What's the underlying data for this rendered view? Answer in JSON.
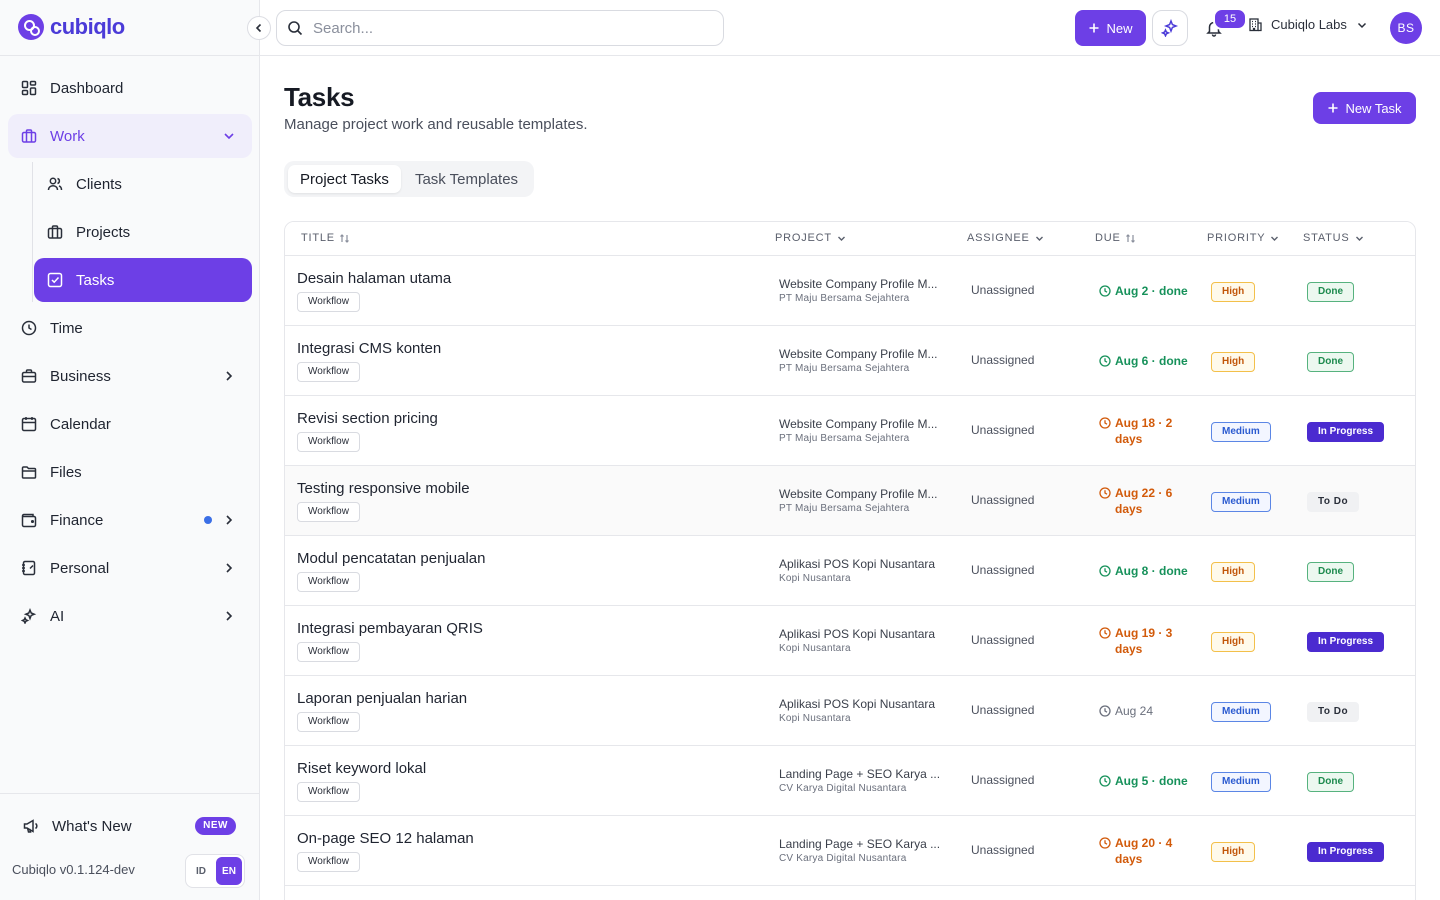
{
  "brand": {
    "name": "cubiqlo"
  },
  "sidebar": {
    "items": [
      {
        "label": "Dashboard",
        "icon": "dashboard-icon"
      },
      {
        "label": "Work",
        "icon": "briefcase-icon",
        "expanded": true,
        "children": [
          {
            "label": "Clients",
            "icon": "users-icon"
          },
          {
            "label": "Projects",
            "icon": "briefcase-icon"
          },
          {
            "label": "Tasks",
            "icon": "checkbox-icon",
            "active": true
          }
        ]
      },
      {
        "label": "Time",
        "icon": "clock-icon"
      },
      {
        "label": "Business",
        "icon": "briefcase-icon"
      },
      {
        "label": "Calendar",
        "icon": "calendar-icon"
      },
      {
        "label": "Files",
        "icon": "folder-icon"
      },
      {
        "label": "Finance",
        "icon": "wallet-icon",
        "indicator": true
      },
      {
        "label": "Personal",
        "icon": "notebook-icon"
      },
      {
        "label": "AI",
        "icon": "sparkles-icon"
      }
    ],
    "whats_new": {
      "label": "What's New",
      "badge": "NEW"
    },
    "version": "Cubiqlo v0.1.124-dev",
    "languages": [
      "ID",
      "EN"
    ],
    "active_language": "EN"
  },
  "topbar": {
    "search_placeholder": "Search...",
    "new_label": "New",
    "notification_count": "15",
    "org_name": "Cubiqlo Labs",
    "avatar_initials": "BS"
  },
  "page": {
    "title": "Tasks",
    "subtitle": "Manage project work and reusable templates.",
    "new_task_label": "New Task",
    "tabs": [
      "Project Tasks",
      "Task Templates"
    ],
    "active_tab": "Project Tasks"
  },
  "table": {
    "columns": [
      "Title",
      "Project",
      "Assignee",
      "Due",
      "Priority",
      "Status"
    ],
    "rows": [
      {
        "title": "Desain halaman utama",
        "tag": "Workflow",
        "project": "Website Company Profile M...",
        "client": "PT Maju Bersama Sejahtera",
        "assignee": "Unassigned",
        "due": "Aug 2 · done",
        "due_state": "done",
        "priority": "High",
        "status": "Done"
      },
      {
        "title": "Integrasi CMS konten",
        "tag": "Workflow",
        "project": "Website Company Profile M...",
        "client": "PT Maju Bersama Sejahtera",
        "assignee": "Unassigned",
        "due": "Aug 6 · done",
        "due_state": "done",
        "priority": "High",
        "status": "Done"
      },
      {
        "title": "Revisi section pricing",
        "tag": "Workflow",
        "project": "Website Company Profile M...",
        "client": "PT Maju Bersama Sejahtera",
        "assignee": "Unassigned",
        "due": "Aug 18 · 2 days",
        "due_state": "soon",
        "priority": "Medium",
        "status": "In Progress"
      },
      {
        "title": "Testing responsive mobile",
        "tag": "Workflow",
        "project": "Website Company Profile M...",
        "client": "PT Maju Bersama Sejahtera",
        "assignee": "Unassigned",
        "due": "Aug 22 · 6 days",
        "due_state": "soon",
        "priority": "Medium",
        "status": "To Do"
      },
      {
        "title": "Modul pencatatan penjualan",
        "tag": "Workflow",
        "project": "Aplikasi POS Kopi Nusantara",
        "client": "Kopi Nusantara",
        "assignee": "Unassigned",
        "due": "Aug 8 · done",
        "due_state": "done",
        "priority": "High",
        "status": "Done"
      },
      {
        "title": "Integrasi pembayaran QRIS",
        "tag": "Workflow",
        "project": "Aplikasi POS Kopi Nusantara",
        "client": "Kopi Nusantara",
        "assignee": "Unassigned",
        "due": "Aug 19 · 3 days",
        "due_state": "soon",
        "priority": "High",
        "status": "In Progress"
      },
      {
        "title": "Laporan penjualan harian",
        "tag": "Workflow",
        "project": "Aplikasi POS Kopi Nusantara",
        "client": "Kopi Nusantara",
        "assignee": "Unassigned",
        "due": "Aug 24",
        "due_state": "later",
        "priority": "Medium",
        "status": "To Do"
      },
      {
        "title": "Riset keyword lokal",
        "tag": "Workflow",
        "project": "Landing Page + SEO Karya ...",
        "client": "CV Karya Digital Nusantara",
        "assignee": "Unassigned",
        "due": "Aug 5 · done",
        "due_state": "done",
        "priority": "Medium",
        "status": "Done"
      },
      {
        "title": "On-page SEO 12 halaman",
        "tag": "Workflow",
        "project": "Landing Page + SEO Karya ...",
        "client": "CV Karya Digital Nusantara",
        "assignee": "Unassigned",
        "due": "Aug 20 · 4 days",
        "due_state": "soon",
        "priority": "High",
        "status": "In Progress"
      }
    ]
  },
  "colors": {
    "accent": "#6d3fe6",
    "status_in_progress": "#4b2bd0",
    "due_done": "#16915a",
    "due_soon": "#d25a0a"
  }
}
